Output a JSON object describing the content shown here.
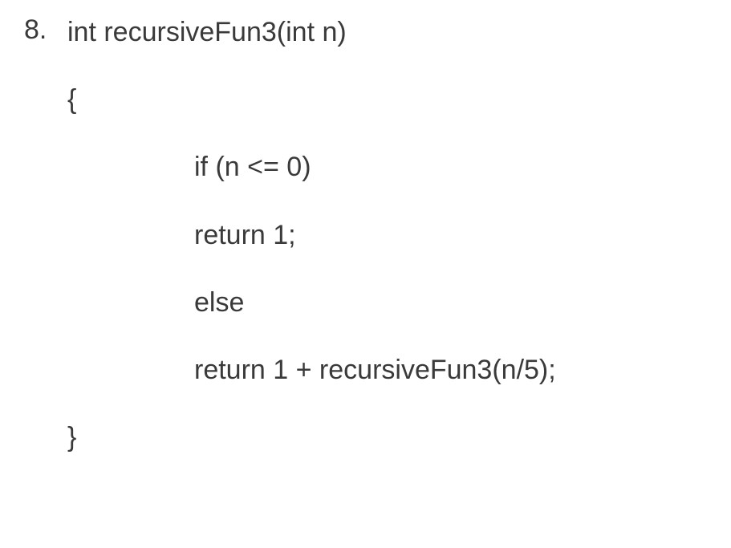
{
  "item": {
    "marker": "8.",
    "lines": [
      {
        "text": "int recursiveFun3(int n)",
        "indent": false
      },
      {
        "text": "{",
        "indent": false
      },
      {
        "text": "if (n <= 0)",
        "indent": true
      },
      {
        "text": "return 1;",
        "indent": true
      },
      {
        "text": "else",
        "indent": true
      },
      {
        "text": "return 1 + recursiveFun3(n/5);",
        "indent": true
      },
      {
        "text": "}",
        "indent": false
      }
    ]
  }
}
